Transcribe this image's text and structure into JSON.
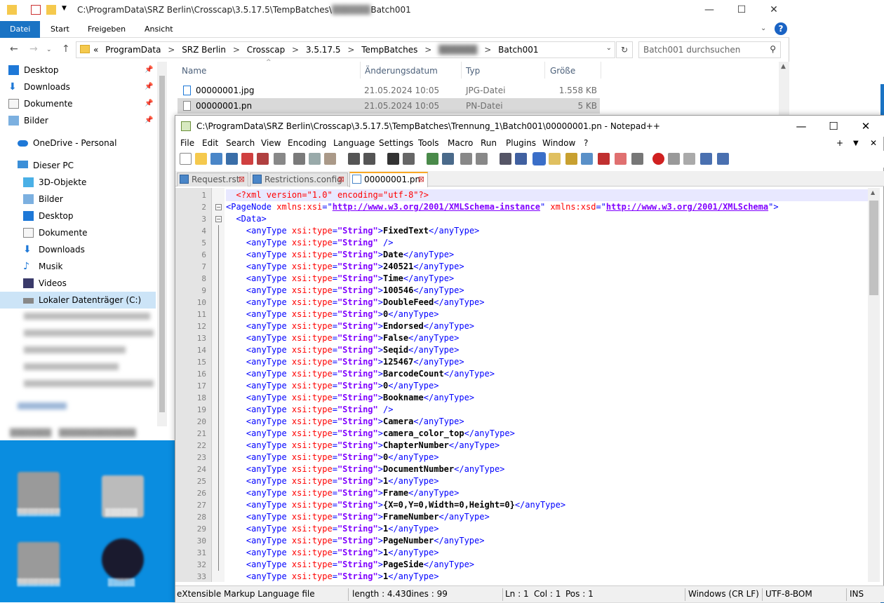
{
  "explorer": {
    "title_path": "C:\\ProgramData\\SRZ Berlin\\Crosscap\\3.5.17.5\\TempBatches\\",
    "title_tail": "Batch001",
    "ribbon_tabs": [
      "Datei",
      "Start",
      "Freigeben",
      "Ansicht"
    ],
    "breadcrumbs": [
      "«",
      "ProgramData",
      ">",
      "SRZ Berlin",
      ">",
      "Crosscap",
      ">",
      "3.5.17.5",
      ">",
      "TempBatches",
      ">",
      "",
      ">",
      "Batch001"
    ],
    "search_placeholder": "Batch001 durchsuchen",
    "sidebar": [
      {
        "label": "Desktop",
        "icon": "desktop-icon",
        "pinned": true
      },
      {
        "label": "Downloads",
        "icon": "download-icon",
        "pinned": true
      },
      {
        "label": "Dokumente",
        "icon": "document-icon",
        "pinned": true
      },
      {
        "label": "Bilder",
        "icon": "pictures-icon",
        "pinned": true
      },
      {
        "label": "OneDrive - Personal",
        "icon": "onedrive-icon"
      },
      {
        "label": "Dieser PC",
        "icon": "computer-icon"
      },
      {
        "label": "3D-Objekte",
        "icon": "3d-objects-icon"
      },
      {
        "label": "Bilder",
        "icon": "pictures-icon"
      },
      {
        "label": "Desktop",
        "icon": "desktop-icon"
      },
      {
        "label": "Dokumente",
        "icon": "document-icon"
      },
      {
        "label": "Downloads",
        "icon": "download-icon"
      },
      {
        "label": "Musik",
        "icon": "music-icon"
      },
      {
        "label": "Videos",
        "icon": "video-icon"
      },
      {
        "label": "Lokaler Datenträger (C:)",
        "icon": "drive-icon"
      }
    ],
    "columns": [
      "Name",
      "Änderungsdatum",
      "Typ",
      "Größe"
    ],
    "files": [
      {
        "name": "00000001.jpg",
        "date": "21.05.2024 10:05",
        "type": "JPG-Datei",
        "size": "1.558 KB"
      },
      {
        "name": "00000001.pn",
        "date": "21.05.2024 10:05",
        "type": "PN-Datei",
        "size": "5 KB"
      }
    ]
  },
  "notepad": {
    "title": "C:\\ProgramData\\SRZ Berlin\\Crosscap\\3.5.17.5\\TempBatches\\Trennung_1\\Batch001\\00000001.pn - Notepad++",
    "menu": [
      "File",
      "Edit",
      "Search",
      "View",
      "Encoding",
      "Language",
      "Settings",
      "Tools",
      "Macro",
      "Run",
      "Plugins",
      "Window",
      "?"
    ],
    "menu_right": [
      "+",
      "▼",
      "✕"
    ],
    "tabs": [
      "Request.rst",
      "Restrictions.config",
      "00000001.pn"
    ],
    "header_lines": {
      "l1": "<?xml version=\"1.0\" encoding=\"utf-8\"?>",
      "ns1": "http://www.w3.org/2001/XMLSchema-instance",
      "ns2": "http://www.w3.org/2001/XMLSchema"
    },
    "values": [
      "FixedText",
      "",
      "Date",
      "240521",
      "Time",
      "100546",
      "DoubleFeed",
      "0",
      "Endorsed",
      "False",
      "Seqid",
      "125467",
      "BarcodeCount",
      "0",
      "Bookname",
      "",
      "Camera",
      "camera_color_top",
      "ChapterNumber",
      "0",
      "DocumentNumber",
      "1",
      "Frame",
      "{X=0,Y=0,Width=0,Height=0}",
      "FrameNumber",
      "1",
      "PageNumber",
      "1",
      "PageSide",
      "1"
    ],
    "status": {
      "filetype": "eXtensible Markup Language file",
      "length": "length : 4.430",
      "lines": "lines : 99",
      "ln": "Ln : 1",
      "col": "Col : 1",
      "pos": "Pos : 1",
      "eol": "Windows (CR LF)",
      "enc": "UTF-8-BOM",
      "mode": "INS"
    }
  }
}
